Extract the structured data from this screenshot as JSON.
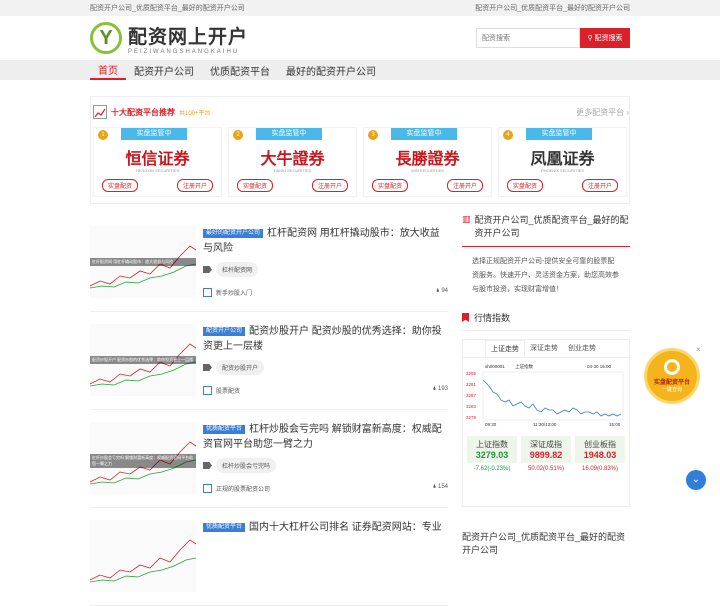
{
  "topbar": {
    "left": "配资开户公司_优质配资平台_最好的配资开户公司",
    "right": "配资开户公司_优质配资平台_最好的配资开户公司"
  },
  "header": {
    "logo_cn": "配资网上开户",
    "logo_en": "PEIZIWANGSHANGKAIHU",
    "search_placeholder": "配资搜索",
    "search_button": "配资搜索"
  },
  "nav": [
    "首页",
    "配资开户公司",
    "优质配资平台",
    "最好的配资开户公司"
  ],
  "recommend": {
    "title": "十大配资平台推荐",
    "count": "共100+平台",
    "more": "更多配资平台",
    "cards": [
      {
        "rank": "1",
        "badge": "实盘监管中",
        "brand": "恒信证券",
        "brand_en": "HENGXIN SECURITIES",
        "color": "#c8161d",
        "btn1": "实盘配资",
        "btn2": "注册开户"
      },
      {
        "rank": "2",
        "badge": "实盘监管中",
        "brand": "大牛證券",
        "brand_en": "DANIU SECURITIES",
        "color": "#c8161d",
        "btn1": "实盘配资",
        "btn2": "注册开户"
      },
      {
        "rank": "3",
        "badge": "实盘监管中",
        "brand": "長勝證券",
        "brand_en": "WIN SECURITIES",
        "color": "#c8161d",
        "btn1": "实盘配资",
        "btn2": "注册开户"
      },
      {
        "rank": "4",
        "badge": "实盘监管中",
        "brand": "凤凰证券",
        "brand_en": "PHOENIX SECURITIES",
        "color": "#333333",
        "btn1": "实盘配资",
        "btn2": "注册开户"
      }
    ]
  },
  "articles": [
    {
      "category": "最好的配资开户公司",
      "title": "杠杆配资网 用杠杆撬动股市：放大收益与风险",
      "tag": "杠杆配资网",
      "source": "新手炒股入门",
      "views": "94",
      "thumb_caption": "杠杆配资网 用杠杆撬动股市：放大收益与风险"
    },
    {
      "category": "配资开户公司",
      "title": "配资炒股开户 配资炒股的优秀选择：助你投资更上一层楼",
      "tag": "配资炒股开户",
      "source": "股票配资",
      "views": "193",
      "thumb_caption": "配资炒股开户 配资炒股的优秀选择：助你投资更上一层楼"
    },
    {
      "category": "优质配资平台",
      "title": "杠杆炒股会亏完吗 解锁财富新高度：权威配资官网平台助您一臂之力",
      "tag": "杠杆炒股会亏完吗",
      "source": "正规的股票配资公司",
      "views": "154",
      "thumb_caption": "杠杆炒股会亏完吗 解锁财富新高度：权威配资官网平台助您一臂之力"
    },
    {
      "category": "优质配资平台",
      "title": "国内十大杠杆公司排名 证券配资网站：专业",
      "tag": "",
      "source": "",
      "views": "",
      "thumb_caption": ""
    }
  ],
  "sidebar": {
    "title": "配资开户公司_优质配资平台_最好的配资开户公司",
    "desc": "选择正规配资开户公司-提供安全可靠的股票配资服务。快速开户、灵活资金方案，助您高效参与股市投资，实现财富增值！",
    "quote_title": "行情指数",
    "tabs": [
      "上证走势",
      "深证走势",
      "创业走势"
    ],
    "chart_label_code": "sh000001",
    "chart_label_name": "上证指数",
    "chart_time": "04-30 15:00",
    "chart_y": [
      "3295",
      "3291",
      "3287",
      "3283",
      "3279"
    ],
    "chart_x": [
      "09:30",
      "11:30/13:00",
      "15:00"
    ],
    "indices": [
      {
        "name": "上证指数",
        "value": "3279.03",
        "change": "-7.62(-0.23%)",
        "dir": "down"
      },
      {
        "name": "深证成指",
        "value": "9899.82",
        "change": "50.02(0.51%)",
        "dir": "up"
      },
      {
        "name": "创业板指",
        "value": "1948.03",
        "change": "16.09(0.83%)",
        "dir": "up"
      }
    ],
    "bottom_title": "配资开户公司_优质配资平台_最好的配资开户公司"
  },
  "float": {
    "line1": "实盘配资平台",
    "line2": "一键查询",
    "close": "×",
    "top": "⌄"
  }
}
